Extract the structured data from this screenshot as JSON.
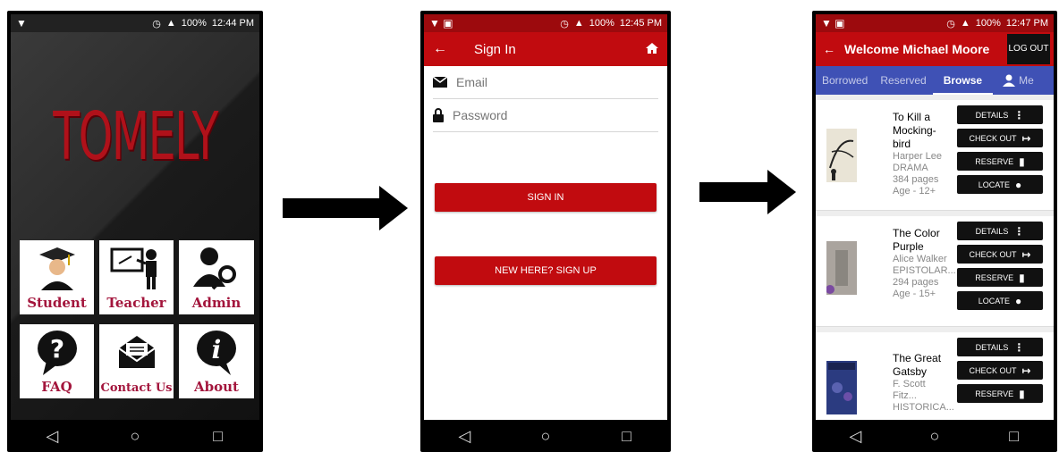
{
  "screen1": {
    "status": {
      "battery": "100%",
      "time": "12:44 PM"
    },
    "logo": "TOMELY",
    "tiles": [
      {
        "label": "Student",
        "icon": "graduate-icon"
      },
      {
        "label": "Teacher",
        "icon": "teacher-icon"
      },
      {
        "label": "Admin",
        "icon": "admin-key-icon"
      },
      {
        "label": "FAQ",
        "icon": "question-bubble-icon"
      },
      {
        "label": "Contact Us",
        "icon": "envelope-icon"
      },
      {
        "label": "About",
        "icon": "info-icon"
      }
    ]
  },
  "screen2": {
    "status": {
      "battery": "100%",
      "time": "12:45 PM"
    },
    "title": "Sign In",
    "email_placeholder": "Email",
    "password_placeholder": "Password",
    "sign_in_label": "SIGN IN",
    "sign_up_label": "NEW HERE? SIGN UP"
  },
  "screen3": {
    "status": {
      "battery": "100%",
      "time": "12:47 PM"
    },
    "title": "Welcome Michael Moore",
    "logout_label": "LOG OUT",
    "tabs": [
      "Borrowed",
      "Reserved",
      "Browse",
      "Me"
    ],
    "active_tab": "Browse",
    "actions": {
      "details": "DETAILS",
      "checkout": "CHECK OUT",
      "reserve": "RESERVE",
      "locate": "LOCATE"
    },
    "books": [
      {
        "title": "To Kill a Mocking-bird",
        "author": "Harper Lee",
        "genre": "DRAMA",
        "pages": "384 pages",
        "age": "Age - 12+"
      },
      {
        "title": "The Color Purple",
        "author": "Alice Walker",
        "genre": "EPISTOLAR...",
        "pages": "294 pages",
        "age": "Age - 15+"
      },
      {
        "title": "The Great Gatsby",
        "author": "F. Scott Fitz...",
        "genre": "HISTORICA...",
        "pages": "",
        "age": ""
      }
    ]
  },
  "colors": {
    "primary_red": "#c10b0f",
    "tab_blue": "#3f51b5",
    "tile_text": "#a3153c"
  }
}
